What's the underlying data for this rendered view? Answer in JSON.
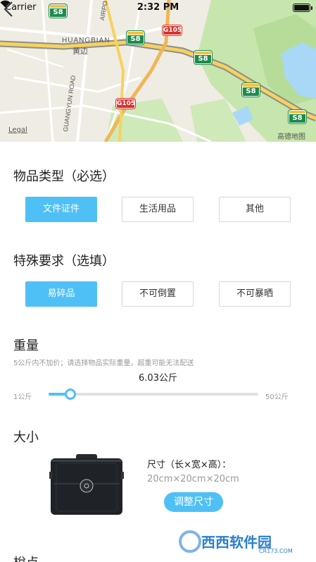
{
  "status_bar": {
    "carrier": "Carrier",
    "time": "2:32 PM"
  },
  "map": {
    "labels": {
      "huangbian_en": "HUANGBIAN",
      "huangbian_cn": "黄边",
      "airport_road": "AIRPO",
      "guangyun_road": "GUANGYUN ROAD"
    },
    "shields": {
      "s8": "S8",
      "g105": "G105"
    },
    "legal": "Legal",
    "provider": "高德地图"
  },
  "item_type": {
    "title": "物品类型（必选）",
    "options": [
      "文件证件",
      "生活用品",
      "其他"
    ],
    "selected_index": 0
  },
  "special": {
    "title": "特殊要求（选填）",
    "options": [
      "易碎品",
      "不可倒置",
      "不可暴晒"
    ],
    "selected_index": 0
  },
  "weight": {
    "title": "重量",
    "hint": "5公斤内不加价；请选择物品实际重量，超重可能无法配送",
    "value": "6.03公斤",
    "min_label": "1公斤",
    "max_label": "50公斤",
    "min": 1,
    "max": 50,
    "current": 6.03
  },
  "size": {
    "title": "大小",
    "label": "尺寸（长×宽×高）：",
    "value": "20cm×20cm×20cm",
    "adjust_button": "调整尺寸"
  },
  "next_section": {
    "title": "梲点"
  },
  "watermark": {
    "brand": "西西软件园",
    "domain": "CR173.COM"
  },
  "colors": {
    "accent": "#4fc0f5",
    "map_road": "#f7d25c",
    "map_green": "#bfe3a5",
    "map_water": "#a8d8f5"
  }
}
